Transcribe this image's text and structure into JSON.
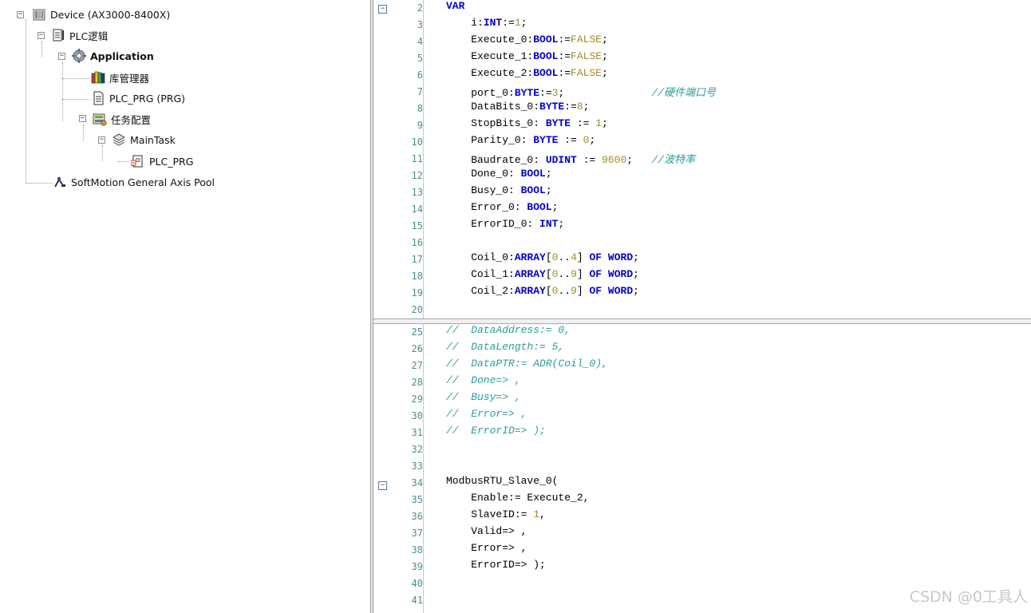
{
  "tree": {
    "device": "Device (AX3000-8400X)",
    "plc_logic": "PLC逻辑",
    "application": "Application",
    "library_manager": "库管理器",
    "plc_prg": "PLC_PRG (PRG)",
    "task_config": "任务配置",
    "main_task": "MainTask",
    "main_task_prg": "PLC_PRG",
    "softmotion_pool": "SoftMotion General Axis Pool",
    "expanders": [
      "−",
      "−",
      "−",
      "−",
      "−"
    ]
  },
  "editor": {
    "fold_marks": [
      "−",
      "−"
    ],
    "declarations": {
      "line_numbers": [
        "2",
        "3",
        "4",
        "5",
        "6",
        "7",
        "8",
        "9",
        "10",
        "11",
        "12",
        "13",
        "14",
        "15",
        "16",
        "17",
        "18",
        "19",
        "20"
      ],
      "lines": [
        [
          "VAR"
        ],
        [
          "    i:",
          "INT",
          ":=",
          "1",
          ";"
        ],
        [
          "    Execute_0:",
          "BOOL",
          ":=",
          "FALSE",
          ";"
        ],
        [
          "    Execute_1:",
          "BOOL",
          ":=",
          "FALSE",
          ";"
        ],
        [
          "    Execute_2:",
          "BOOL",
          ":=",
          "FALSE",
          ";"
        ],
        [
          "    port_0:",
          "BYTE",
          ":=",
          "3",
          ";",
          "              ",
          "//硬件端口号"
        ],
        [
          "    DataBits_0:",
          "BYTE",
          ":=",
          "8",
          ";"
        ],
        [
          "    StopBits_0: ",
          "BYTE",
          " := ",
          "1",
          ";"
        ],
        [
          "    Parity_0: ",
          "BYTE",
          " := ",
          "0",
          ";"
        ],
        [
          "    Baudrate_0: ",
          "UDINT",
          " := ",
          "9600",
          ";   ",
          "//波特率"
        ],
        [
          "    Done_0: ",
          "BOOL",
          ";"
        ],
        [
          "    Busy_0: ",
          "BOOL",
          ";"
        ],
        [
          "    Error_0: ",
          "BOOL",
          ";"
        ],
        [
          "    ErrorID_0: ",
          "INT",
          ";"
        ],
        [
          ""
        ],
        [
          "    Coil_0:",
          "ARRAY",
          "[",
          "0",
          "..",
          "4",
          "] ",
          "OF",
          " ",
          "WORD",
          ";"
        ],
        [
          "    Coil_1:",
          "ARRAY",
          "[",
          "0",
          "..",
          "9",
          "] ",
          "OF",
          " ",
          "WORD",
          ";"
        ],
        [
          "    Coil_2:",
          "ARRAY",
          "[",
          "0",
          "..",
          "9",
          "] ",
          "OF",
          " ",
          "WORD",
          ";"
        ],
        [
          ""
        ]
      ]
    },
    "body": {
      "line_numbers": [
        "25",
        "26",
        "27",
        "28",
        "29",
        "30",
        "31",
        "32",
        "33",
        "34",
        "35",
        "36",
        "37",
        "38",
        "39",
        "40",
        "41"
      ],
      "lines": [
        "//  DataAddress:= 0,",
        "//  DataLength:= 5,",
        "//  DataPTR:= ADR(Coil_0),",
        "//  Done=> ,",
        "//  Busy=> ,",
        "//  Error=> ,",
        "//  ErrorID=> );",
        "",
        "",
        "ModbusRTU_Slave_0(",
        "    Enable:= Execute_2,",
        "    SlaveID:= 1,",
        "    Valid=> ,",
        "    Error=> ,",
        "    ErrorID=> );",
        "",
        ""
      ]
    }
  },
  "watermark": "CSDN @0工具人"
}
